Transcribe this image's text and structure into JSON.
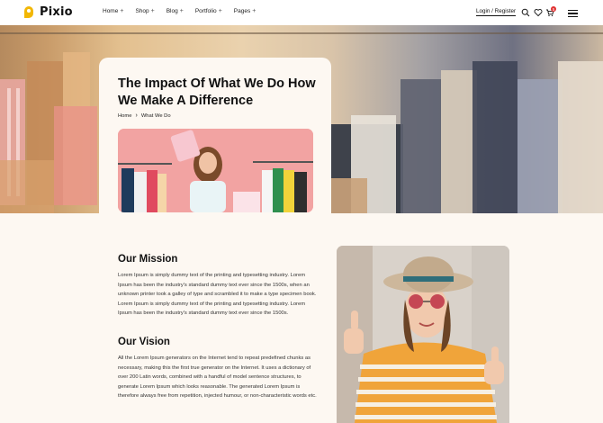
{
  "brand": {
    "name": "Pixio",
    "accent": "#f2b705"
  },
  "nav": [
    {
      "label": "Home"
    },
    {
      "label": "Shop"
    },
    {
      "label": "Blog"
    },
    {
      "label": "Portfolio"
    },
    {
      "label": "Pages"
    }
  ],
  "header": {
    "login_label": "Login / Register",
    "cart_count": "5",
    "icons": [
      "search-icon",
      "heart-icon",
      "cart-icon",
      "menu-icon"
    ]
  },
  "hero": {
    "title": "The Impact Of What We Do How We Make A Difference",
    "breadcrumb": {
      "home": "Home",
      "current": "What We Do"
    }
  },
  "mission": {
    "heading": "Our Mission",
    "text": "Lorem Ipsum is simply dummy text of the printing and typesetting industry. Lorem Ipsum has been the industry's standard dummy text ever since the 1500s, when an unknown printer took a galley of type and scrambled it to make a type specimen book. Lorem Ipsum is simply dummy text of the printing and typesetting industry. Lorem Ipsum has been the industry's standard dummy text ever since the 1500s."
  },
  "vision": {
    "heading": "Our Vision",
    "text": "All the Lorem Ipsum generators on the Internet tend to repeat predefined chunks as necessary, making this the first true generator on the Internet. It uses a dictionary of over 200 Latin words, combined with a handful of model sentence structures, to generate Lorem Ipsum which looks reasonable. The generated Lorem Ipsum is therefore always free from repetition, injected humour, or non-characteristic words etc."
  }
}
